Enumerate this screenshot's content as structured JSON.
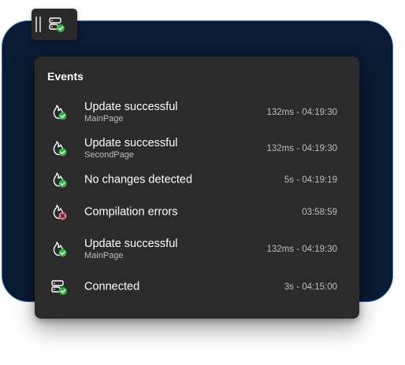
{
  "toolbar": {
    "grip_icon": "grip-icon",
    "status_icon": "server-check-icon"
  },
  "panel": {
    "title": "Events",
    "events": [
      {
        "title": "Update successful",
        "subtitle": "MainPage",
        "time": "132ms - 04:19:30",
        "icon": "flame-check-icon"
      },
      {
        "title": "Update successful",
        "subtitle": "SecondPage",
        "time": "132ms - 04:19:30",
        "icon": "flame-check-icon"
      },
      {
        "title": "No changes detected",
        "subtitle": "",
        "time": "5s - 04:19:19",
        "icon": "flame-check-icon"
      },
      {
        "title": "Compilation errors",
        "subtitle": "",
        "time": "03:58:59",
        "icon": "flame-error-icon"
      },
      {
        "title": "Update successful",
        "subtitle": "MainPage",
        "time": "132ms - 04:19:30",
        "icon": "flame-check-icon"
      },
      {
        "title": "Connected",
        "subtitle": "",
        "time": "3s - 04:15:00",
        "icon": "server-check-icon"
      }
    ]
  },
  "colors": {
    "success": "#2fb344",
    "error": "#e8737e",
    "panel_bg": "#2b2b2b",
    "backdrop": "#0b1b33",
    "backdrop_border": "#2a74c9"
  }
}
